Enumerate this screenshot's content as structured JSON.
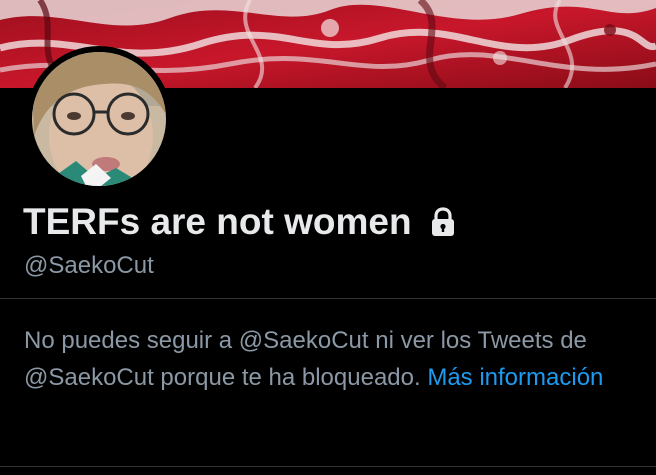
{
  "profile": {
    "display_name": "TERFs are not women",
    "handle": "@SaekoCut",
    "protected_icon": "lock-icon",
    "avatar": "profile-photo",
    "banner": "red-marble-header-image"
  },
  "blocked_notice": {
    "text": "No puedes seguir a @SaekoCut ni ver los Tweets de @SaekoCut porque te ha bloqueado.",
    "link_label": "Más información"
  },
  "colors": {
    "background": "#000000",
    "primary_text": "#e7e9ea",
    "secondary_text": "#8b98a5",
    "link": "#1d9bf0",
    "divider": "#2f3336"
  }
}
